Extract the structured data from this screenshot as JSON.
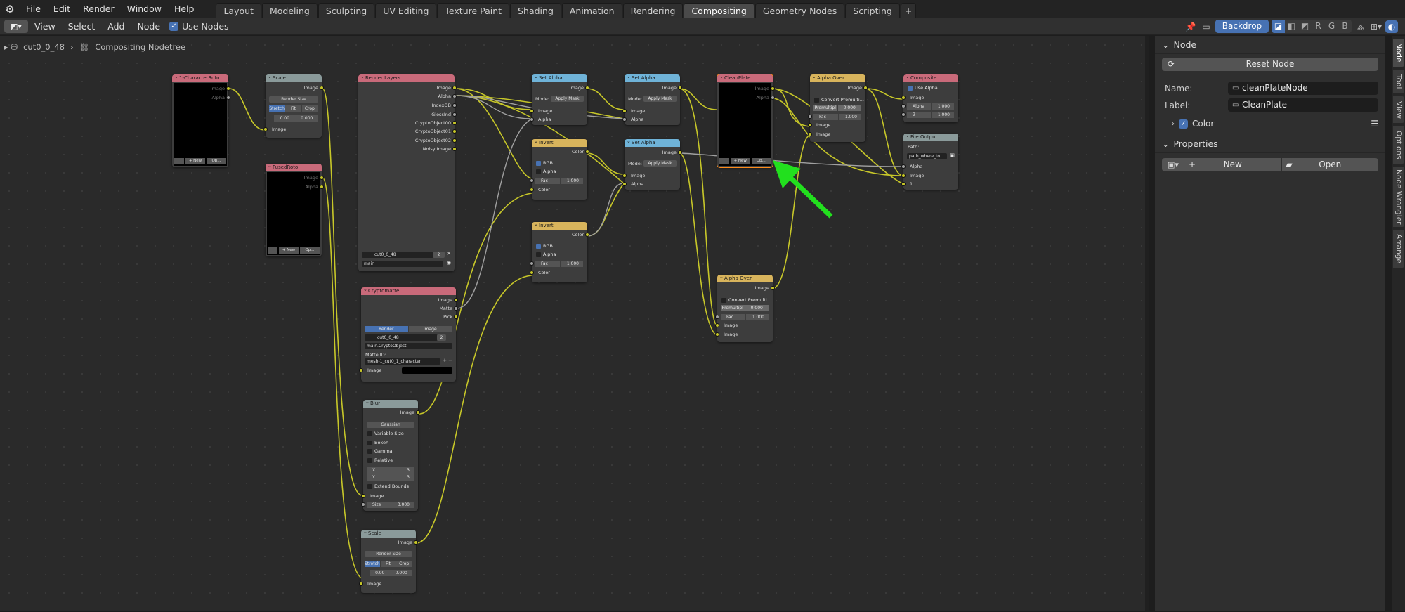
{
  "topbar": {
    "menus": [
      "File",
      "Edit",
      "Render",
      "Window",
      "Help"
    ],
    "tabs": [
      "Layout",
      "Modeling",
      "Sculpting",
      "UV Editing",
      "Texture Paint",
      "Shading",
      "Animation",
      "Rendering",
      "Compositing",
      "Geometry Nodes",
      "Scripting",
      "+"
    ],
    "active_tab": "Compositing"
  },
  "header": {
    "menus": [
      "View",
      "Select",
      "Add",
      "Node"
    ],
    "use_nodes_label": "Use Nodes",
    "backdrop_label": "Backdrop",
    "channels": [
      "",
      "",
      "",
      "R",
      "G",
      "B"
    ]
  },
  "breadcrumb": {
    "scene": "cut0_0_48",
    "tree": "Compositing Nodetree"
  },
  "nodes": {
    "charroto": {
      "title": "1-CharacterRoto",
      "outputs": [
        "Image",
        "Alpha"
      ],
      "new": "+ New",
      "open": "Op..."
    },
    "scale1": {
      "title": "Scale",
      "out": "Image",
      "mode": "Render Size",
      "fit": [
        "Stretch",
        "Fit",
        "Crop"
      ],
      "x": "0.00",
      "y": "0.000",
      "in": "Image"
    },
    "fusedroto": {
      "title": "FusedRoto",
      "outputs": [
        "Image",
        "Alpha"
      ],
      "new": "+ New",
      "open": "Op..."
    },
    "renderlayers": {
      "title": "Render Layers",
      "outputs": [
        "Image",
        "Alpha",
        "IndexOB",
        "GlossInd",
        "CryptoObject00",
        "CryptoObject01",
        "CryptoObject02",
        "Noisy Image"
      ],
      "scene": "cut0_0_48",
      "count": "2",
      "layer": "main"
    },
    "crypto": {
      "title": "Cryptomatte",
      "outputs": [
        "Image",
        "Matte",
        "Pick"
      ],
      "src": [
        "Render",
        "Image"
      ],
      "scene": "cut0_0_48",
      "count": "2",
      "layer": "main.CryptoObject",
      "matte_label": "Matte ID:",
      "matte": "mesh-1_cut0_1_character",
      "in": "Image"
    },
    "blur": {
      "title": "Blur",
      "out": "Image",
      "type": "Gaussian",
      "opts": [
        "Variable Size",
        "Bokeh",
        "Gamma",
        "Relative"
      ],
      "x_label": "X",
      "x": "3",
      "y_label": "Y",
      "y": "3",
      "extend": "Extend Bounds",
      "in": "Image",
      "size_label": "Size",
      "size": "3.000"
    },
    "scale2": {
      "title": "Scale",
      "out": "Image",
      "mode": "Render Size",
      "fit": [
        "Stretch",
        "Fit",
        "Crop"
      ],
      "x": "0.00",
      "y": "0.000",
      "in": "Image"
    },
    "setalpha1": {
      "title": "Set Alpha",
      "out": "Image",
      "mode_label": "Mode:",
      "mode": "Apply Mask",
      "inputs": [
        "Image",
        "Alpha"
      ]
    },
    "invert1": {
      "title": "Invert",
      "out": "Color",
      "rgb": "RGB",
      "alpha": "Alpha",
      "fac_label": "Fac",
      "fac": "1.000",
      "in": "Color"
    },
    "invert2": {
      "title": "Invert",
      "out": "Color",
      "rgb": "RGB",
      "alpha": "Alpha",
      "fac_label": "Fac",
      "fac": "1.000",
      "in": "Color"
    },
    "setalpha2": {
      "title": "Set Alpha",
      "out": "Image",
      "mode_label": "Mode:",
      "mode": "Apply Mask",
      "inputs": [
        "Image",
        "Alpha"
      ]
    },
    "setalpha3": {
      "title": "Set Alpha",
      "out": "Image",
      "mode_label": "Mode:",
      "mode": "Apply Mask",
      "inputs": [
        "Image",
        "Alpha"
      ]
    },
    "cleanplate": {
      "title": "CleanPlate",
      "outputs": [
        "Image",
        "Alpha"
      ],
      "new": "+ New",
      "open": "Op..."
    },
    "alphaover1": {
      "title": "Alpha Over",
      "out": "Image",
      "convert": "Convert Premulti...",
      "premul_label": "Premultipl",
      "premul": "0.000",
      "fac_label": "Fac",
      "fac": "1.000",
      "inputs": [
        "Image",
        "Image"
      ]
    },
    "alphaover2": {
      "title": "Alpha Over",
      "out": "Image",
      "convert": "Convert Premulti...",
      "premul_label": "Premultipl",
      "premul": "0.000",
      "fac_label": "Fac",
      "fac": "1.000",
      "inputs": [
        "Image",
        "Image"
      ]
    },
    "composite": {
      "title": "Composite",
      "use_alpha": "Use Alpha",
      "inputs": [
        "Image"
      ],
      "alpha_label": "Alpha",
      "alpha": "1.000",
      "z_label": "Z",
      "z": "1.000"
    },
    "fileoutput": {
      "title": "File Output",
      "path_label": "Path:",
      "path": "path_where_to...",
      "inputs": [
        "Alpha",
        "Image",
        "1"
      ]
    }
  },
  "sidebar": {
    "node_panel_title": "Node",
    "reset_label": "Reset Node",
    "name_label": "Name:",
    "name_value": "cleanPlateNode",
    "label_label": "Label:",
    "label_value": "CleanPlate",
    "color_label": "Color",
    "properties_title": "Properties",
    "new_label": "New",
    "open_label": "Open",
    "tabs": [
      "Node",
      "Tool",
      "View",
      "Options",
      "Node Wrangler",
      "Arrange"
    ]
  },
  "colors": {
    "accent": "#4772b3",
    "socket": "#c7c729",
    "arrow": "#22e01e",
    "selection": "#ff8c1a"
  }
}
